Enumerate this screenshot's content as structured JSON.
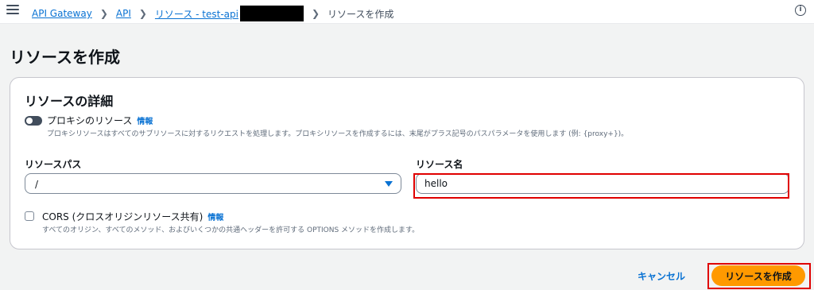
{
  "breadcrumb": {
    "items": [
      "API Gateway",
      "API",
      "リソース - test-api"
    ],
    "current": "リソースを作成"
  },
  "page": {
    "title": "リソースを作成"
  },
  "panel": {
    "title": "リソースの詳細",
    "proxy": {
      "label": "プロキシのリソース",
      "info": "情報",
      "description": "プロキシリソースはすべてのサブリソースに対するリクエストを処理します。プロキシリソースを作成するには、末尾がプラス記号のパスパラメータを使用します (例: {proxy+})。",
      "enabled": false
    },
    "resource_path": {
      "label": "リソースパス",
      "value": "/"
    },
    "resource_name": {
      "label": "リソース名",
      "value": "hello"
    },
    "cors": {
      "label": "CORS (クロスオリジンリソース共有)",
      "info": "情報",
      "description": "すべてのオリジン、すべてのメソッド、およびいくつかの共通ヘッダーを許可する OPTIONS メソッドを作成します。",
      "checked": false
    }
  },
  "actions": {
    "cancel": "キャンセル",
    "create": "リソースを作成"
  },
  "colors": {
    "accent": "#0972d3",
    "primary_button": "#ff9900",
    "highlight": "#e00000"
  }
}
